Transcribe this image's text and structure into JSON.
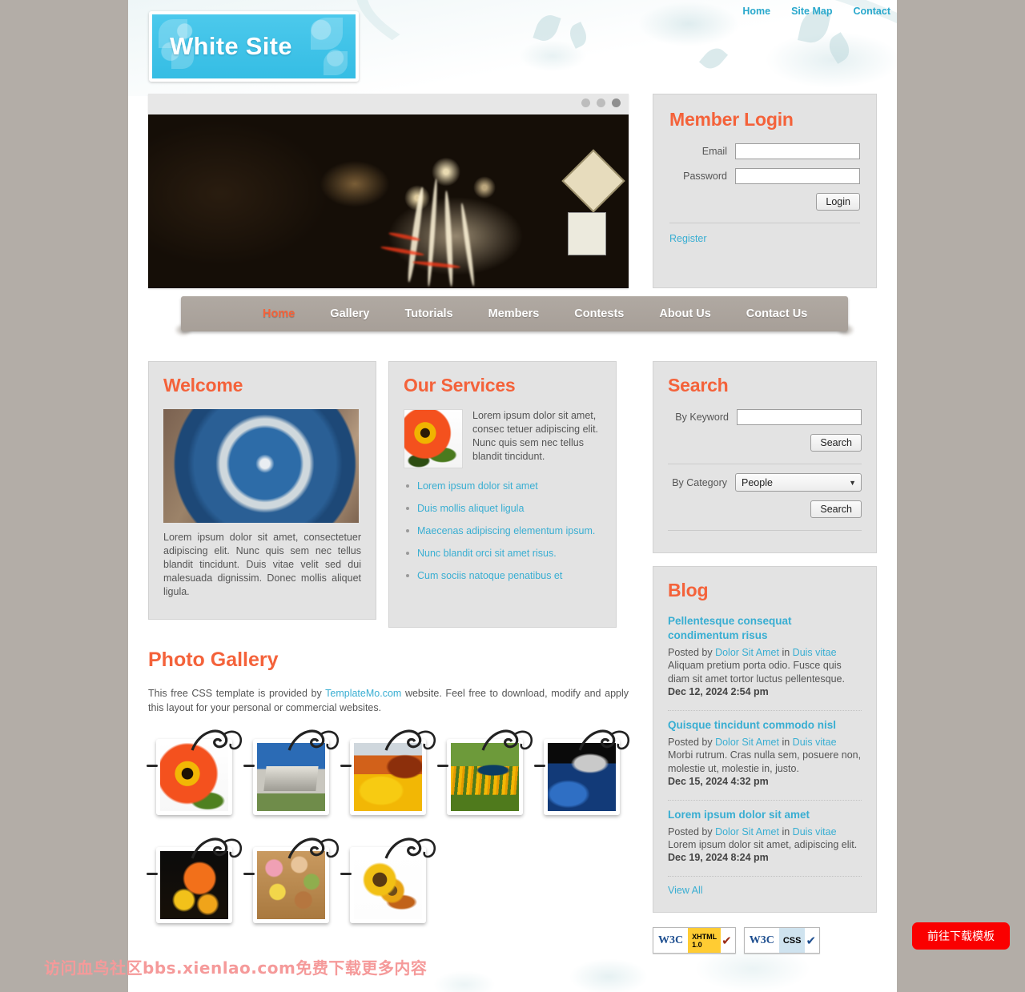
{
  "site": {
    "logo_text": "White Site"
  },
  "topnav": {
    "items": [
      {
        "label": "Home"
      },
      {
        "label": "Site Map"
      },
      {
        "label": "Contact"
      }
    ]
  },
  "mainnav": {
    "items": [
      {
        "label": "Home",
        "active": true
      },
      {
        "label": "Gallery",
        "active": false
      },
      {
        "label": "Tutorials",
        "active": false
      },
      {
        "label": "Members",
        "active": false
      },
      {
        "label": "Contests",
        "active": false
      },
      {
        "label": "About Us",
        "active": false
      },
      {
        "label": "Contact Us",
        "active": false
      }
    ]
  },
  "slider": {
    "image_alt": "night-city-street-light-trails",
    "dots": [
      "inactive",
      "inactive",
      "active"
    ]
  },
  "login": {
    "title": "Member Login",
    "email_label": "Email",
    "email_value": "",
    "password_label": "Password",
    "password_value": "",
    "login_button": "Login",
    "register_link": "Register"
  },
  "welcome": {
    "title": "Welcome",
    "image_alt": "globe-earth-photo",
    "text": "Lorem ipsum dolor sit amet, consectetuer adipiscing elit. Nunc quis sem nec tellus blandit tincidunt. Duis vitae velit sed dui malesuada dignissim. Donec mollis aliquet ligula."
  },
  "services": {
    "title": "Our Services",
    "image_alt": "orange-gerbera-flower-photo",
    "intro": "Lorem ipsum dolor sit amet, consec tetuer adipiscing elit. Nunc quis sem nec tellus blandit tincidunt.",
    "links": [
      {
        "label": "Lorem ipsum dolor sit amet"
      },
      {
        "label": "Duis mollis aliquet ligula"
      },
      {
        "label": "Maecenas adipiscing elementum ipsum."
      },
      {
        "label": "Nunc blandit orci sit amet risus."
      },
      {
        "label": "Cum sociis natoque penatibus et"
      }
    ]
  },
  "search": {
    "title": "Search",
    "keyword_label": "By Keyword",
    "keyword_value": "",
    "keyword_button": "Search",
    "category_label": "By Category",
    "category_value": "People",
    "category_button": "Search"
  },
  "blog": {
    "title": "Blog",
    "posts": [
      {
        "title": "Pellentesque consequat condimentum risus",
        "posted_by_prefix": "Posted by",
        "author": "Dolor Sit Amet",
        "in_word": "in",
        "category": "Duis vitae",
        "excerpt": "Aliquam pretium porta odio. Fusce quis diam sit amet tortor luctus pellentesque.",
        "date": "Dec 12, 2024 2:54 pm"
      },
      {
        "title": "Quisque tincidunt commodo nisl",
        "posted_by_prefix": "Posted by",
        "author": "Dolor Sit Amet",
        "in_word": "in",
        "category": "Duis vitae",
        "excerpt": "Morbi rutrum. Cras nulla sem, posuere non, molestie ut, molestie in, justo.",
        "date": "Dec 15, 2024 4:32 pm"
      },
      {
        "title": "Lorem ipsum dolor sit amet",
        "posted_by_prefix": "Posted by",
        "author": "Dolor Sit Amet",
        "in_word": "in",
        "category": "Duis vitae",
        "excerpt": "Lorem ipsum dolor sit amet, adipiscing elit.",
        "date": "Dec 19, 2024 8:24 pm"
      }
    ],
    "view_all": "View All"
  },
  "gallery": {
    "title": "Photo Gallery",
    "desc_before": "This free CSS template is provided by ",
    "desc_link": "TemplateMo.com",
    "desc_after": " website. Feel free to download, modify and apply this layout for your personal or commercial websites.",
    "items": [
      {
        "alt": "orange-gerbera-flower"
      },
      {
        "alt": "rusty-ship-on-shore"
      },
      {
        "alt": "yellow-red-flower-closeup"
      },
      {
        "alt": "peacock-in-yellow-flower-field"
      },
      {
        "alt": "blue-feathers-texture"
      },
      {
        "alt": "pumpkin-and-fruit-still-life"
      },
      {
        "alt": "colorful-candy-almonds"
      },
      {
        "alt": "sunflowers-autumn-arrangement"
      }
    ]
  },
  "validators": {
    "xhtml": {
      "org": "W3C",
      "label_line1": "XHTML",
      "label_line2": "1.0",
      "check": "✔"
    },
    "css": {
      "org": "W3C",
      "label_line1": "CSS",
      "check": "✔"
    }
  },
  "overlay": {
    "watermark": "访问血鸟社区bbs.xienlao.com免费下载更多内容",
    "download_button": "前往下载模板"
  },
  "colors": {
    "accent_orange": "#f4623a",
    "link_blue": "#39aed2",
    "logo_cyan": "#35bde4",
    "nav_bar": "#aaa29b",
    "page_bg": "#b3ada7",
    "watermark_red": "#f59a9a",
    "download_button_red": "#fa0000"
  }
}
